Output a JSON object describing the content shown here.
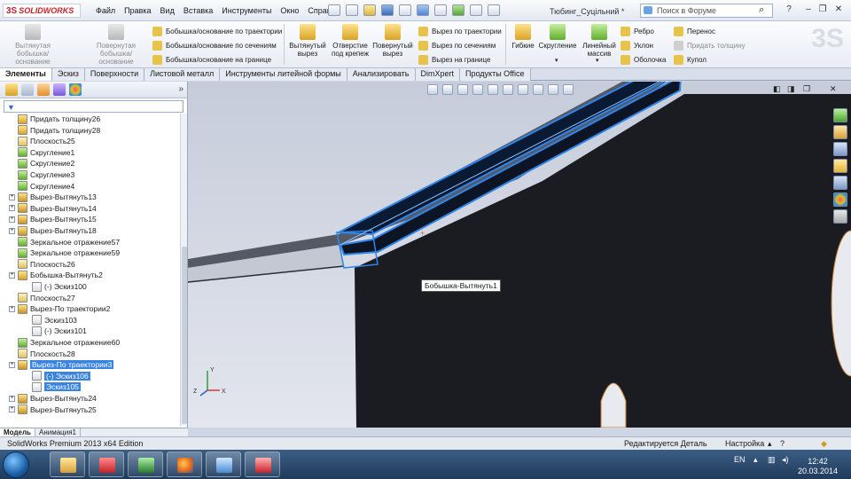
{
  "app": {
    "logo": "SOLIDWORKS",
    "document_title": "Тюбинг_Суцільний *"
  },
  "menu": [
    "Файл",
    "Правка",
    "Вид",
    "Вставка",
    "Инструменты",
    "Окно",
    "Справка"
  ],
  "search": {
    "placeholder": "Поиск в Форуме"
  },
  "command_manager": {
    "big_buttons": [
      {
        "label": "Вытянутая бобышка/основание",
        "enabled": false
      },
      {
        "label": "Повернутая бобышка/основание",
        "enabled": false
      },
      {
        "label": "Вытянутый вырез",
        "enabled": true
      },
      {
        "label": "Отверстие под крепеж",
        "enabled": true
      },
      {
        "label": "Повернутый вырез",
        "enabled": true
      },
      {
        "label": "Гибкие",
        "enabled": true
      },
      {
        "label": "Скругление",
        "enabled": true
      },
      {
        "label": "Линейный массив",
        "enabled": true
      }
    ],
    "boss_small": [
      {
        "label": "Бобышка/основание по траектории",
        "enabled": true
      },
      {
        "label": "Бобышка/основание по сечениям",
        "enabled": true
      },
      {
        "label": "Бобышка/основание на границе",
        "enabled": true
      }
    ],
    "cut_small": [
      {
        "label": "Вырез по траектории",
        "enabled": true
      },
      {
        "label": "Вырез по сечениям",
        "enabled": true
      },
      {
        "label": "Вырез на границе",
        "enabled": true
      }
    ],
    "features_small": [
      {
        "label": "Ребро",
        "enabled": true
      },
      {
        "label": "Уклон",
        "enabled": true
      },
      {
        "label": "Оболочка",
        "enabled": true
      }
    ],
    "extra_small": [
      {
        "label": "Перенос",
        "enabled": true
      },
      {
        "label": "Придать толщину",
        "enabled": false
      },
      {
        "label": "Купол",
        "enabled": true
      }
    ]
  },
  "tabs": [
    {
      "label": "Элементы",
      "active": true
    },
    {
      "label": "Эскиз",
      "active": false
    },
    {
      "label": "Поверхности",
      "active": false
    },
    {
      "label": "Листовой металл",
      "active": false
    },
    {
      "label": "Инструменты литейной формы",
      "active": false
    },
    {
      "label": "Анализировать",
      "active": false
    },
    {
      "label": "DimXpert",
      "active": false
    },
    {
      "label": "Продукты Office",
      "active": false
    }
  ],
  "feature_tree": [
    {
      "label": "Придать толщину26",
      "icon": "thicken-icon",
      "expandable": false,
      "level": 0
    },
    {
      "label": "Придать толщину28",
      "icon": "thicken-icon",
      "expandable": false,
      "level": 0
    },
    {
      "label": "Плоскость25",
      "icon": "plane-icon",
      "expandable": false,
      "level": 0
    },
    {
      "label": "Скругление1",
      "icon": "fillet-icon",
      "expandable": false,
      "level": 0
    },
    {
      "label": "Скругление2",
      "icon": "fillet-icon",
      "expandable": false,
      "level": 0
    },
    {
      "label": "Скругление3",
      "icon": "fillet-icon",
      "expandable": false,
      "level": 0
    },
    {
      "label": "Скругление4",
      "icon": "fillet-icon",
      "expandable": false,
      "level": 0
    },
    {
      "label": "Вырез-Вытянуть13",
      "icon": "cut-extrude-icon",
      "expandable": true,
      "level": 0
    },
    {
      "label": "Вырез-Вытянуть14",
      "icon": "cut-extrude-icon",
      "expandable": true,
      "level": 0
    },
    {
      "label": "Вырез-Вытянуть15",
      "icon": "cut-extrude-icon",
      "expandable": true,
      "level": 0
    },
    {
      "label": "Вырез-Вытянуть18",
      "icon": "cut-extrude-icon",
      "expandable": true,
      "level": 0
    },
    {
      "label": "Зеркальное отражение57",
      "icon": "mirror-icon",
      "expandable": false,
      "level": 0
    },
    {
      "label": "Зеркальное отражение59",
      "icon": "mirror-icon",
      "expandable": false,
      "level": 0
    },
    {
      "label": "Плоскость26",
      "icon": "plane-icon",
      "expandable": false,
      "level": 0
    },
    {
      "label": "Бобышка-Вытянуть2",
      "icon": "boss-extrude-icon",
      "expandable": true,
      "level": 0
    },
    {
      "label": "(-) Эскиз100",
      "icon": "sketch-icon",
      "expandable": false,
      "level": 1
    },
    {
      "label": "Плоскость27",
      "icon": "plane-icon",
      "expandable": false,
      "level": 0
    },
    {
      "label": "Вырез-По траектории2",
      "icon": "cut-sweep-icon",
      "expandable": true,
      "level": 0
    },
    {
      "label": "Эскиз103",
      "icon": "sketch-icon",
      "expandable": false,
      "level": 1
    },
    {
      "label": "(-) Эскиз101",
      "icon": "sketch-icon",
      "expandable": false,
      "level": 1
    },
    {
      "label": "Зеркальное отражение60",
      "icon": "mirror-icon",
      "expandable": false,
      "level": 0
    },
    {
      "label": "Плоскость28",
      "icon": "plane-icon",
      "expandable": false,
      "level": 0
    },
    {
      "label": "Вырез-По траектории3",
      "icon": "cut-sweep-icon",
      "expandable": true,
      "level": 0,
      "selected": true
    },
    {
      "label": "(-) Эскиз106",
      "icon": "sketch-icon",
      "expandable": false,
      "level": 1,
      "selected": true
    },
    {
      "label": "Эскиз105",
      "icon": "sketch-icon",
      "expandable": false,
      "level": 1,
      "selected": true
    },
    {
      "label": "Вырез-Вытянуть24",
      "icon": "cut-extrude-icon",
      "expandable": true,
      "level": 0
    },
    {
      "label": "Вырез-Вытянуть25",
      "icon": "cut-extrude-icon",
      "expandable": true,
      "level": 0
    }
  ],
  "viewport": {
    "hover_label": "Бобышка-Вытянуть1",
    "triad": {
      "x": "X",
      "y": "Y",
      "z": "Z"
    }
  },
  "model_tabs": [
    {
      "label": "Модель",
      "active": true
    },
    {
      "label": "Анимация1",
      "active": false
    }
  ],
  "status": {
    "edition": "SolidWorks Premium 2013 x64 Edition",
    "editing": "Редактируется Деталь",
    "settings": "Настройка"
  },
  "taskbar": {
    "language": "EN",
    "time": "12:42",
    "date": "20.03.2014",
    "apps": [
      "explorer-icon",
      "solidworks-icon",
      "task-manager-icon",
      "firefox-icon",
      "network-app-icon",
      "pdf-icon"
    ]
  },
  "colors": {
    "selection": "#3a83e0",
    "model_dark": "#1a1c22",
    "model_gray": "#555966",
    "highlight_edge": "#2f86e8",
    "brand_red": "#c8202a"
  }
}
